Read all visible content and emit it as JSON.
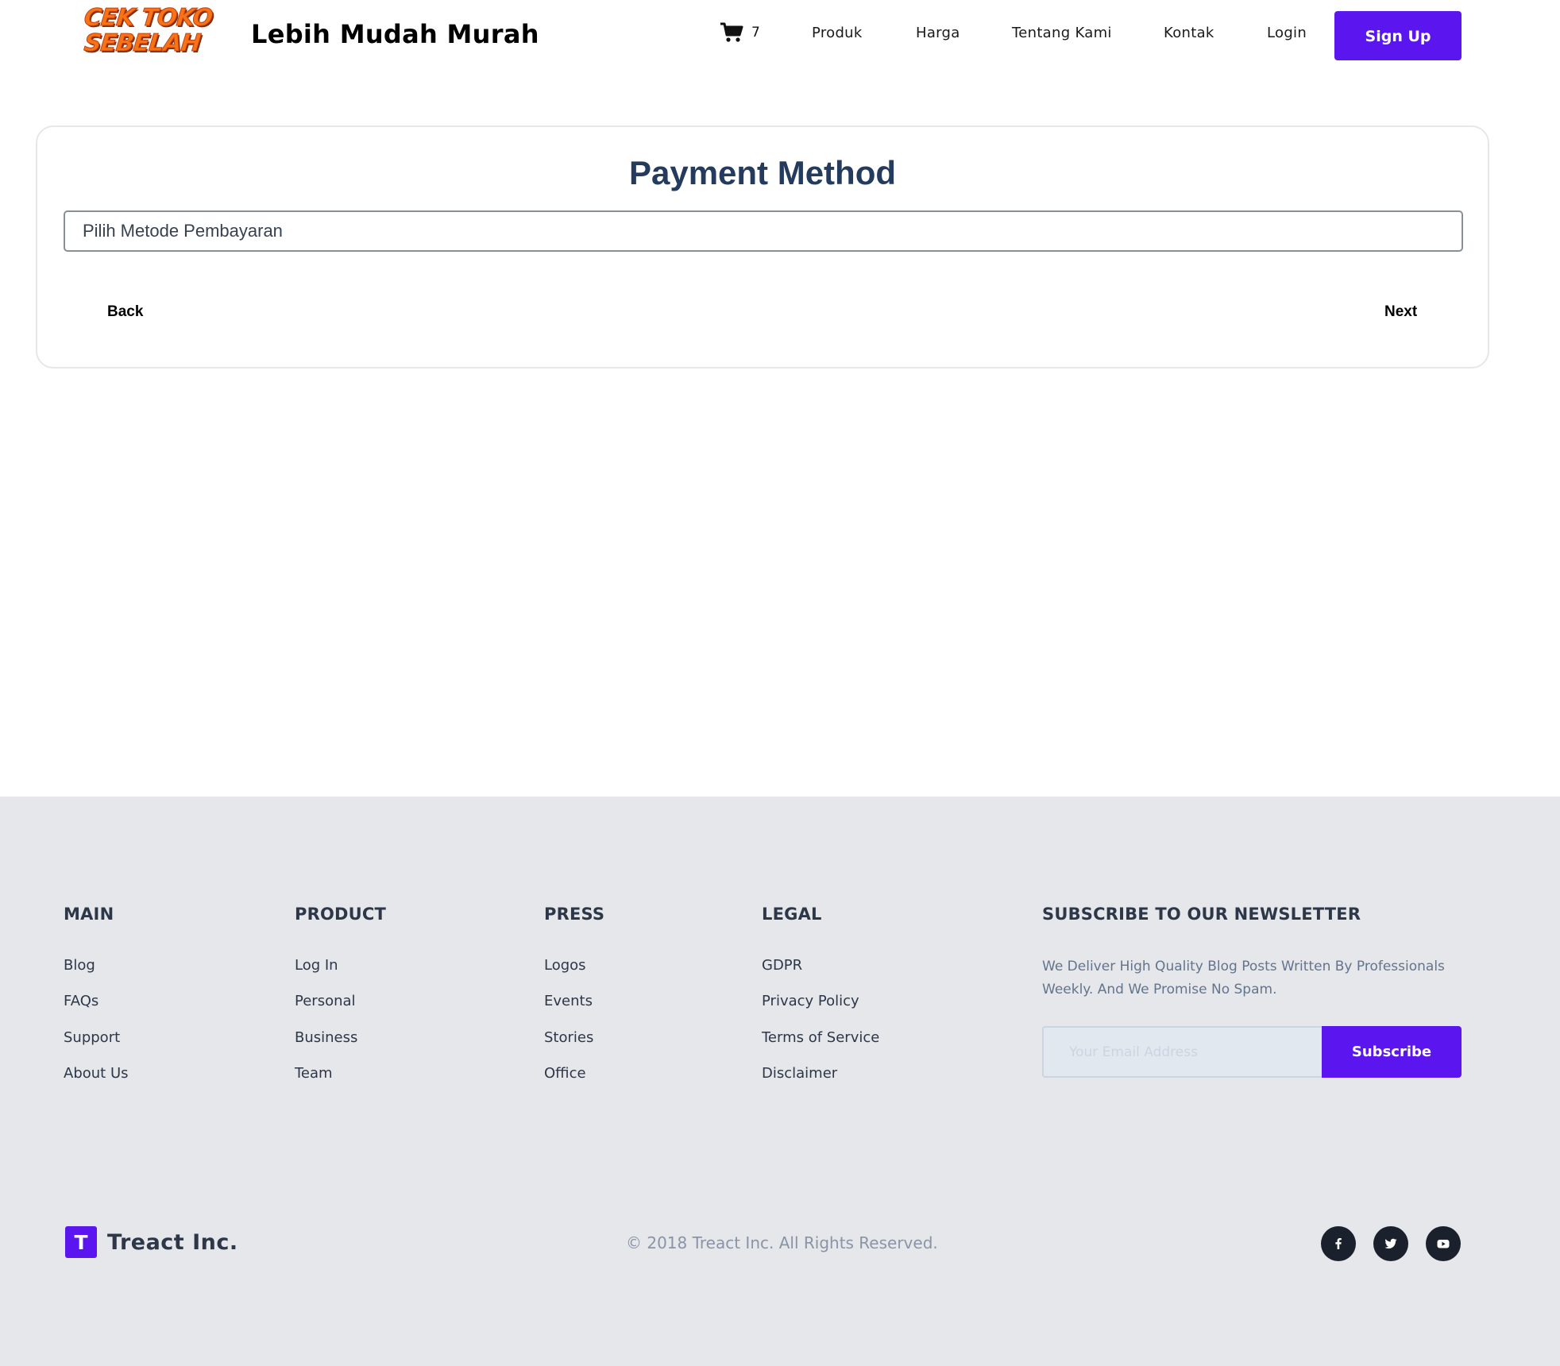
{
  "header": {
    "logo_line1": "CEK TOKO",
    "logo_line2": "SEBELAH",
    "tagline": "Lebih Mudah Murah",
    "cart_count": "7",
    "nav": {
      "produk": "Produk",
      "harga": "Harga",
      "tentang": "Tentang Kami",
      "kontak": "Kontak",
      "login": "Login"
    },
    "signup_label": "Sign Up"
  },
  "payment": {
    "title": "Payment Method",
    "select_value": "Pilih Metode Pembayaran",
    "back_label": "Back",
    "next_label": "Next"
  },
  "footer": {
    "columns": [
      {
        "heading": "MAIN",
        "links": [
          "Blog",
          "FAQs",
          "Support",
          "About Us"
        ]
      },
      {
        "heading": "PRODUCT",
        "links": [
          "Log In",
          "Personal",
          "Business",
          "Team"
        ]
      },
      {
        "heading": "PRESS",
        "links": [
          "Logos",
          "Events",
          "Stories",
          "Office"
        ]
      },
      {
        "heading": "LEGAL",
        "links": [
          "GDPR",
          "Privacy Policy",
          "Terms of Service",
          "Disclaimer"
        ]
      }
    ],
    "newsletter": {
      "heading": "SUBSCRIBE TO OUR NEWSLETTER",
      "text": "We Deliver High Quality Blog Posts Written By Professionals Weekly. And We Promise No Spam.",
      "email_placeholder": "Your Email Address",
      "subscribe_label": "Subscribe"
    },
    "brand_letter": "T",
    "brand_name": "Treact Inc.",
    "copyright": "© 2018 Treact Inc. All Rights Reserved.",
    "social_icons": [
      "facebook-icon",
      "twitter-icon",
      "youtube-icon"
    ]
  },
  "colors": {
    "accent": "#5b16ef",
    "title": "#243b5e",
    "footer_bg": "#e5e7eb",
    "logo": "#f97316"
  }
}
